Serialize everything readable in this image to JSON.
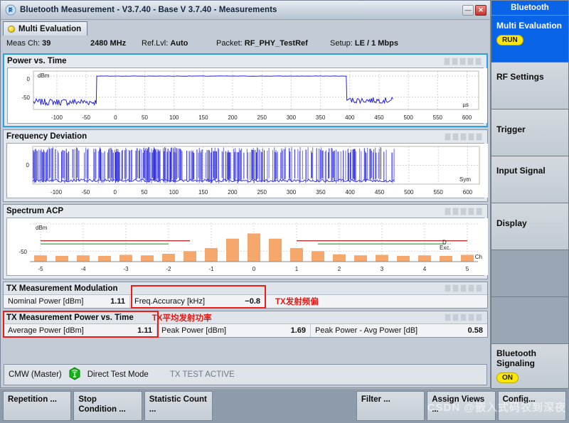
{
  "window": {
    "title": "Bluetooth Measurement  - V3.7.40 - Base V 3.7.40 - Measurements",
    "icon": "bluetooth-icon",
    "minimize_label": "—",
    "close_label": "✕"
  },
  "tab": {
    "label": "Multi Evaluation",
    "status_icon": "yellow-status-dot"
  },
  "infobar": {
    "meas_ch_label": "Meas Ch:",
    "meas_ch_value": "39",
    "frequency": "2480 MHz",
    "ref_lvl_label": "Ref.Lvl:",
    "ref_lvl_value": "Auto",
    "packet_label": "Packet:",
    "packet_value": "RF_PHY_TestRef",
    "setup_label": "Setup:",
    "setup_value": "LE / 1 Mbps"
  },
  "panels": [
    {
      "title": "Power vs. Time",
      "indicators": 5
    },
    {
      "title": "Frequency Deviation",
      "indicators": 5
    },
    {
      "title": "Spectrum ACP",
      "indicators": 5
    }
  ],
  "chart_data": [
    {
      "type": "line",
      "title": "Power vs. Time",
      "xlabel": "",
      "ylabel": "dBm",
      "x_unit": "µs",
      "y_unit": "dBm",
      "xlim": [
        -140,
        620
      ],
      "ylim": [
        -80,
        12
      ],
      "xticks": [
        -100,
        -50,
        0,
        50,
        100,
        150,
        200,
        250,
        300,
        350,
        400,
        450,
        500,
        550,
        600
      ],
      "yticks": [
        0,
        -50
      ],
      "grid": true,
      "series": [
        {
          "name": "burst power",
          "description": "Noise floor near -62 dBm before -30 us, flat burst at 0 dBm from -30 us to 395 us, falls back to noise near -58 dBm until 475 us",
          "segments": [
            {
              "x_start": -140,
              "x_end": -32,
              "level": -62,
              "noise": 8
            },
            {
              "x_start": -30,
              "x_end": 395,
              "level": 0,
              "noise": 0.4
            },
            {
              "x_start": 400,
              "x_end": 475,
              "level": -58,
              "noise": 7
            }
          ]
        }
      ]
    },
    {
      "type": "line",
      "title": "Frequency Deviation",
      "xlabel": "",
      "ylabel": "",
      "x_unit": "Sym",
      "xlim": [
        -140,
        620
      ],
      "ylim": [
        -1.3,
        1.3
      ],
      "xticks": [
        -100,
        -50,
        0,
        50,
        100,
        150,
        200,
        250,
        300,
        350,
        400,
        450,
        500,
        550,
        600
      ],
      "yticks": [
        0
      ],
      "grid": true,
      "series": [
        {
          "name": "frequency deviation",
          "description": "Dense GFSK modulation trace oscillating full-scale between -140 and 475 Sym, flat/idle after 475 Sym"
        }
      ]
    },
    {
      "type": "bar",
      "title": "Spectrum ACP",
      "xlabel": "",
      "ylabel": "dBm",
      "x_unit": "Ch",
      "y_unit": "dBm",
      "ylim": [
        -70,
        5
      ],
      "yticks": [
        -50
      ],
      "grid": true,
      "bar_color": "#f6a76b",
      "categories": [
        "-5",
        "-4.5",
        "-4",
        "-3.5",
        "-3",
        "-2.5",
        "-2",
        "-1.5",
        "-1",
        "-0.5",
        "0",
        "0.5",
        "1",
        "1.5",
        "2",
        "2.5",
        "3",
        "3.5",
        "4",
        "4.5",
        "5"
      ],
      "xticks": [
        "-5",
        "-4",
        "-3",
        "-2",
        "-1",
        "0",
        "1",
        "2",
        "3",
        "4",
        "5"
      ],
      "values": [
        -58,
        -59,
        -58,
        -59,
        -57,
        -58,
        -55,
        -50,
        -44,
        -26,
        -16,
        -26,
        -44,
        -50,
        -56,
        -58,
        -57,
        -59,
        -58,
        -59,
        -57
      ],
      "limit_lines": [
        {
          "name": "upper-limit-left",
          "color": "#b03030",
          "y": -30,
          "x_from": "-5",
          "x_to": "-1.5"
        },
        {
          "name": "lower-limit-left",
          "color": "#3f9e3f",
          "y": -36,
          "x_from": "-5",
          "x_to": "-2"
        },
        {
          "name": "upper-limit-right",
          "color": "#b03030",
          "y": -30,
          "x_from": "1",
          "x_to": "5"
        },
        {
          "name": "lower-limit-right",
          "color": "#3f9e3f",
          "y": -36,
          "x_from": "1.5",
          "x_to": "4.5"
        }
      ],
      "annotations": [
        {
          "text": "D...",
          "color": "#b03030"
        },
        {
          "text": "Exc.",
          "color": "#3f9e3f"
        }
      ]
    }
  ],
  "modulation_table": {
    "title": "TX Measurement Modulation",
    "indicators": 5,
    "annotation": "TX发射频偏",
    "rows": [
      {
        "label": "Nominal Power [dBm]",
        "value": "1.11",
        "highlighted": false
      },
      {
        "label": "Freq.Accuracy [kHz]",
        "value": "−0.8",
        "highlighted": true
      }
    ]
  },
  "power_table": {
    "title": "TX Measurement Power vs. Time",
    "indicators": 5,
    "annotation": "TX平均发射功率",
    "rows": [
      {
        "label": "Average Power [dBm]",
        "value": "1.11",
        "highlighted": true
      },
      {
        "label": "Peak Power [dBm]",
        "value": "1.69",
        "highlighted": false
      },
      {
        "label": "Peak Power - Avg Power [dB]",
        "value": "0.58",
        "highlighted": false
      }
    ]
  },
  "statusbar": {
    "device": "CMW (Master)",
    "icon": "antenna-icon",
    "mode": "Direct Test Mode",
    "state": "TX TEST ACTIVE"
  },
  "sidebar": {
    "title": "Bluetooth",
    "items": [
      {
        "label": "Multi Evaluation",
        "state": "RUN",
        "active": true
      },
      {
        "label": "RF Settings",
        "state": null,
        "active": false
      },
      {
        "label": "Trigger",
        "state": null,
        "active": false
      },
      {
        "label": "Input Signal",
        "state": null,
        "active": false
      },
      {
        "label": "Display",
        "state": null,
        "active": false
      },
      {
        "label": "",
        "state": null,
        "active": false,
        "empty": true
      },
      {
        "label": "",
        "state": null,
        "active": false,
        "empty": true
      },
      {
        "label": "Bluetooth Signaling",
        "state": "ON",
        "active": false
      }
    ]
  },
  "softkeys": [
    {
      "label": "Repetition ...",
      "blank": false
    },
    {
      "label": "Stop Condition ...",
      "blank": false
    },
    {
      "label": "Statistic Count ...",
      "blank": false
    },
    {
      "label": "",
      "blank": true
    },
    {
      "label": "",
      "blank": true
    },
    {
      "label": "Filter ...",
      "blank": false
    },
    {
      "label": "Assign Views ...",
      "blank": false
    },
    {
      "label": "Config...",
      "blank": false
    }
  ],
  "watermark": "CSDN @嵌入式码农到深夜"
}
